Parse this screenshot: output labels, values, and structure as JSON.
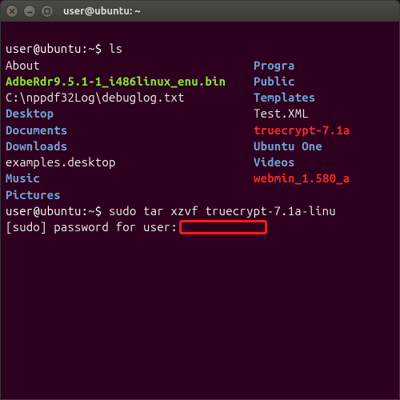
{
  "window": {
    "title": "user@ubuntu: ~"
  },
  "prompt1": "user@ubuntu:~$ ",
  "cmd1": "ls",
  "listing": [
    {
      "c1": {
        "text": "About",
        "cls": "c-white"
      },
      "c2": {
        "text": "Progra",
        "cls": "c-blue"
      }
    },
    {
      "c1": {
        "text": "AdbeRdr9.5.1-1_i486linux_enu.bin",
        "cls": "c-green"
      },
      "c2": {
        "text": "Public",
        "cls": "c-blue"
      }
    },
    {
      "c1": {
        "text": "C:\\nppdf32Log\\debuglog.txt",
        "cls": "c-white"
      },
      "c2": {
        "text": "Templates",
        "cls": "c-blue"
      }
    },
    {
      "c1": {
        "text": "Desktop",
        "cls": "c-blue"
      },
      "c2": {
        "text": "Test.XML",
        "cls": "c-white"
      }
    },
    {
      "c1": {
        "text": "Documents",
        "cls": "c-blue"
      },
      "c2": {
        "text": "truecrypt-7.1a",
        "cls": "c-red"
      }
    },
    {
      "c1": {
        "text": "Downloads",
        "cls": "c-blue"
      },
      "c2": {
        "text": "Ubuntu One",
        "cls": "c-blue"
      }
    },
    {
      "c1": {
        "text": "examples.desktop",
        "cls": "c-white"
      },
      "c2": {
        "text": "Videos",
        "cls": "c-blue"
      }
    },
    {
      "c1": {
        "text": "Music",
        "cls": "c-blue"
      },
      "c2": {
        "text": "webmin_1.580_a",
        "cls": "c-red"
      }
    },
    {
      "c1": {
        "text": "Pictures",
        "cls": "c-blue"
      },
      "c2": {
        "text": "",
        "cls": ""
      }
    }
  ],
  "prompt2": "user@ubuntu:~$ ",
  "cmd2": "sudo tar xzvf truecrypt-7.1a-linu",
  "pwline": "[sudo] password for user:"
}
